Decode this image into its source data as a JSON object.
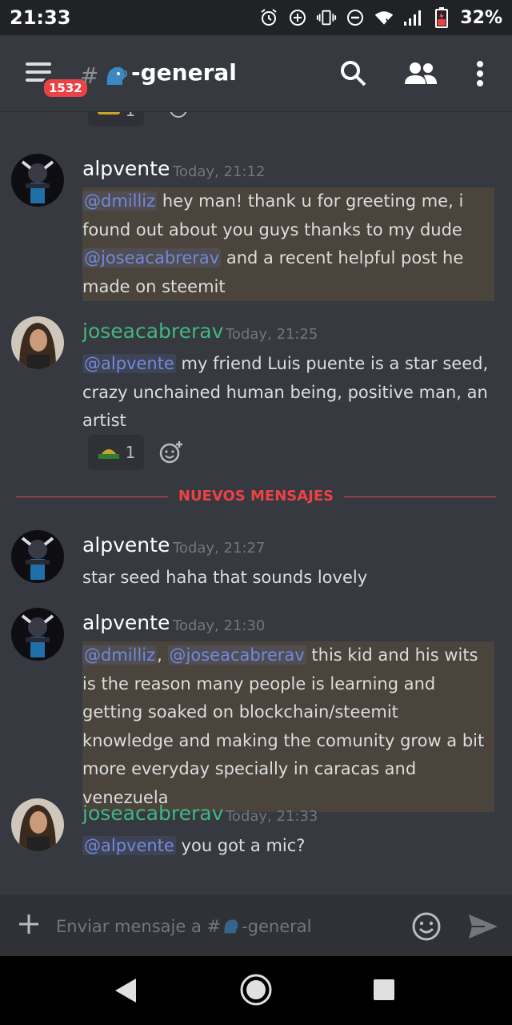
{
  "status_bar": {
    "time": "21:33",
    "battery": "32%",
    "icons": [
      "alarm-icon",
      "data-saver-icon",
      "vibrate-icon",
      "do-not-disturb-icon",
      "wifi-icon",
      "signal-icon",
      "battery-icon"
    ]
  },
  "header": {
    "badge_count": "1532",
    "hash": "#",
    "channel_name": "-general",
    "icons": [
      "menu-icon",
      "search-icon",
      "members-icon",
      "more-icon"
    ]
  },
  "messages": [
    {
      "author": "alpvente",
      "author_color": "#ffffff",
      "timestamp": "Today, 21:12",
      "mentions": [
        "@dmilliz",
        "@joseacabrerav"
      ],
      "text_parts": [
        "hey man! thank u for greeting me, i found out about you guys thanks to my dude",
        "and a recent helpful post he made on steemit"
      ],
      "highlighted": true
    },
    {
      "author": "joseacabrerav",
      "author_color": "#43b581",
      "timestamp": "Today, 21:25",
      "mentions": [
        "@alpvente"
      ],
      "text_parts": [
        "my friend Luis puente is a star seed, crazy unchained human being, positive man, an artist"
      ],
      "highlighted": false,
      "reaction_count": "1"
    },
    {
      "author": "alpvente",
      "author_color": "#ffffff",
      "timestamp": "Today, 21:27",
      "text": "star seed haha that sounds lovely",
      "highlighted": false
    },
    {
      "author": "alpvente",
      "author_color": "#ffffff",
      "timestamp": "Today, 21:30",
      "mentions": [
        "@dmilliz",
        "@joseacabrerav"
      ],
      "text_parts": [
        ",",
        "this kid and his wits is the reason many people is learning and getting soaked on blockchain/steemit knowledge and making the comunity grow a bit more everyday specially in caracas and venezuela"
      ],
      "highlighted": true
    },
    {
      "author": "joseacabrerav",
      "author_color": "#43b581",
      "timestamp": "Today, 21:33",
      "mentions": [
        "@alpvente"
      ],
      "text_parts": [
        "you got a mic?"
      ],
      "highlighted": false
    }
  ],
  "top_reaction_count": "1",
  "divider": {
    "label": "NUEVOS MENSAJES",
    "color": "#ed4245"
  },
  "composer": {
    "placeholder_prefix": "Enviar mensaje a #",
    "placeholder_suffix": "-general"
  },
  "colors": {
    "background": "#36393f",
    "mention": "#7289da",
    "highlight": "#4a443c",
    "accent_red": "#ed4245"
  }
}
